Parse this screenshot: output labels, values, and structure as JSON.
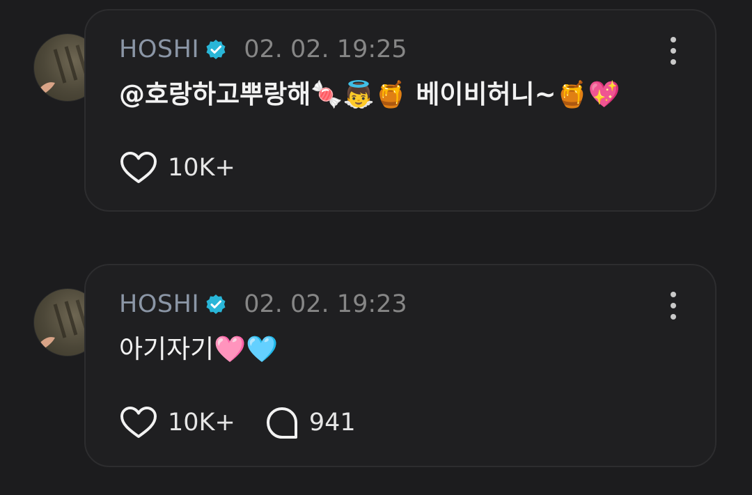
{
  "posts": [
    {
      "username": "HOSHI",
      "timestamp": "02. 02. 19:25",
      "text": "@호랑하고뿌랑해🍬👼🍯 베이비허니~🍯💖",
      "likes": "10K+",
      "comments": null,
      "icons": [
        "avatar",
        "verified-badge-icon",
        "more-vertical-icon",
        "heart-icon"
      ]
    },
    {
      "username": "HOSHI",
      "timestamp": "02. 02. 19:23",
      "text": "아기자기🩷🩵",
      "likes": "10K+",
      "comments": "941",
      "icons": [
        "avatar",
        "verified-badge-icon",
        "more-vertical-icon",
        "heart-icon",
        "comment-icon"
      ]
    }
  ],
  "colors": {
    "background": "#1c1c1e",
    "card": "#1f1f21",
    "card_border": "#2d2d2f",
    "username": "#8b96a6",
    "verified": "#29b6d8",
    "timestamp": "#868686",
    "text": "#f2f2f2"
  }
}
